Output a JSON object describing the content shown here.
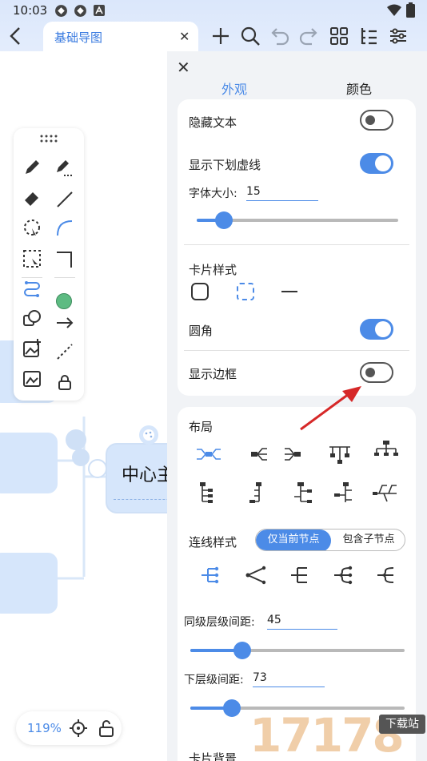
{
  "status_bar": {
    "time": "10:03"
  },
  "tab": {
    "title": "基础导图",
    "close": "✕"
  },
  "canvas": {
    "center_node": "中心主",
    "zoom": "119%"
  },
  "panel": {
    "close": "✕",
    "tabs": [
      {
        "label": "外观"
      },
      {
        "label": "颜色"
      }
    ],
    "hide_text": {
      "label": "隐藏文本",
      "on": false
    },
    "underline": {
      "label": "显示下划虚线",
      "on": true
    },
    "font_size": {
      "label": "字体大小:",
      "value": "15",
      "fraction": 0.15
    },
    "card_style": {
      "label": "卡片样式"
    },
    "rounded": {
      "label": "圆角",
      "on": true
    },
    "border": {
      "label": "显示边框",
      "on": false
    },
    "layout": {
      "label": "布局"
    },
    "line_style": {
      "label": "连线样式",
      "options": [
        "仅当前节点",
        "包含子节点"
      ],
      "selected": 0
    },
    "sibling_spacing": {
      "label": "同级层级间距:",
      "value": "45",
      "fraction": 0.26
    },
    "child_spacing": {
      "label": "下层级间距:",
      "value": "73",
      "fraction": 0.19
    },
    "card_bg": {
      "label": "卡片背景"
    }
  },
  "watermark": {
    "brand": "17178",
    "tag": "下载站"
  },
  "colors": {
    "accent": "#4c8be7",
    "node": "#d6e6fb",
    "green_dot": "#5dbb82"
  }
}
